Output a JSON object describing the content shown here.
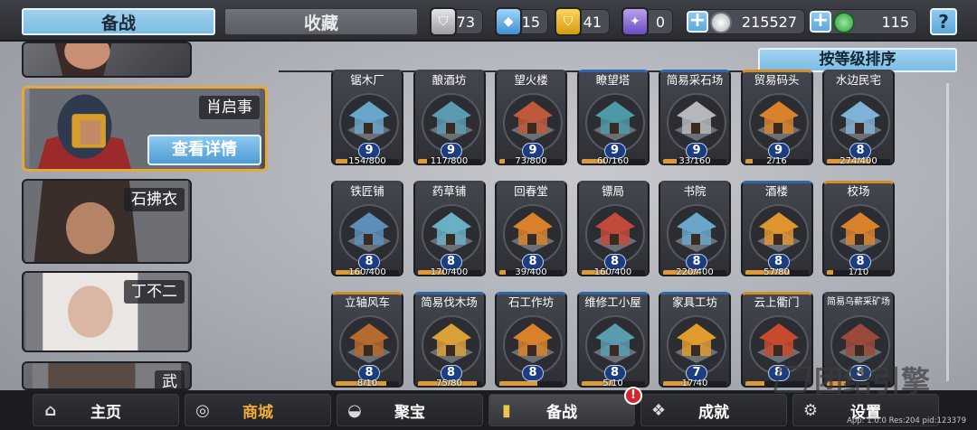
{
  "tabs": {
    "active": "备战",
    "other": "收藏"
  },
  "resources": [
    {
      "icon": "silver-shield-icon",
      "value": "73",
      "color": "#c6c8cd"
    },
    {
      "icon": "blue-crystal-icon",
      "value": "15",
      "color": "#4fa6e6"
    },
    {
      "icon": "gold-shield-icon",
      "value": "41",
      "color": "#e7b022"
    },
    {
      "icon": "purple-crest-icon",
      "value": "0",
      "color": "#8c6bd6"
    }
  ],
  "currency": [
    {
      "icon": "silver-coin-icon",
      "value": "215527",
      "color": "#c2c6cc"
    },
    {
      "icon": "jade-coin-icon",
      "value": "115",
      "color": "#3fb14d"
    }
  ],
  "help_label": "?",
  "heroes": [
    {
      "name": ""
    },
    {
      "name": "肖启事",
      "button": "查看详情"
    },
    {
      "name": "石拂衣"
    },
    {
      "name": "丁不二"
    },
    {
      "name": "武"
    }
  ],
  "sort_label": "按等级排序",
  "buildings": [
    {
      "name": "锯木厂",
      "level": "9",
      "progress": "154/800",
      "pct": 0.19,
      "tint": "#3f434b",
      "accent": "#6aa6c9"
    },
    {
      "name": "酿酒坊",
      "level": "9",
      "progress": "117/800",
      "pct": 0.15,
      "tint": "#3f434b",
      "accent": "#5b9bb0"
    },
    {
      "name": "望火楼",
      "level": "9",
      "progress": "73/800",
      "pct": 0.09,
      "tint": "#3f434b",
      "accent": "#c0583c"
    },
    {
      "name": "瞭望塔",
      "level": "9",
      "progress": "60/160",
      "pct": 0.38,
      "tint": "#2f66a8",
      "accent": "#4d9aa6"
    },
    {
      "name": "简易采石场",
      "level": "9",
      "progress": "33/160",
      "pct": 0.21,
      "tint": "#2f66a8",
      "accent": "#b5b7bb"
    },
    {
      "name": "贸易码头",
      "level": "9",
      "progress": "2/16",
      "pct": 0.12,
      "tint": "#d28a2a",
      "accent": "#d9822b"
    },
    {
      "name": "水边民宅",
      "level": "8",
      "progress": "274/400",
      "pct": 0.68,
      "tint": "#3f434b",
      "accent": "#7fb2d6"
    },
    {
      "name": "铁匠铺",
      "level": "8",
      "progress": "160/400",
      "pct": 0.4,
      "tint": "#3f434b",
      "accent": "#5b8fb8"
    },
    {
      "name": "药草铺",
      "level": "8",
      "progress": "170/400",
      "pct": 0.42,
      "tint": "#3f434b",
      "accent": "#6ab0c4"
    },
    {
      "name": "回春堂",
      "level": "8",
      "progress": "39/400",
      "pct": 0.1,
      "tint": "#3f434b",
      "accent": "#d9822b"
    },
    {
      "name": "镖局",
      "level": "8",
      "progress": "160/400",
      "pct": 0.4,
      "tint": "#3f434b",
      "accent": "#c24a3a"
    },
    {
      "name": "书院",
      "level": "8",
      "progress": "220/400",
      "pct": 0.55,
      "tint": "#3f434b",
      "accent": "#6aa6c9"
    },
    {
      "name": "酒楼",
      "level": "8",
      "progress": "57/80",
      "pct": 0.71,
      "tint": "#2f66a8",
      "accent": "#e0952f"
    },
    {
      "name": "校场",
      "level": "8",
      "progress": "1/10",
      "pct": 0.1,
      "tint": "#d28a2a",
      "accent": "#d9822b"
    },
    {
      "name": "立轴风车",
      "level": "8",
      "progress": "8/10",
      "pct": 0.8,
      "tint": "#d28a2a",
      "accent": "#b56a2e"
    },
    {
      "name": "简易伐木场",
      "level": "8",
      "progress": "75/80",
      "pct": 0.94,
      "tint": "#2f66a8",
      "accent": "#d9a13a"
    },
    {
      "name": "石工作坊",
      "level": "8",
      "progress": "",
      "pct": 0.6,
      "tint": "#2f66a8",
      "accent": "#d9822b"
    },
    {
      "name": "维修工小屋",
      "level": "8",
      "progress": "5/10",
      "pct": 0.5,
      "tint": "#2f66a8",
      "accent": "#5b9bb0"
    },
    {
      "name": "家具工坊",
      "level": "7",
      "progress": "17/40",
      "pct": 0.42,
      "tint": "#2f66a8",
      "accent": "#e09b2f"
    },
    {
      "name": "云上衢门",
      "level": "8",
      "progress": "",
      "pct": 0.3,
      "tint": "#d28a2a",
      "accent": "#c84a2e"
    },
    {
      "name": "简易乌薪采矿场",
      "level": "8",
      "progress": "",
      "pct": 0.3,
      "tint": "#3f434b",
      "accent": "#9a4a3a"
    }
  ],
  "nav": [
    {
      "label": "主页",
      "icon": "home-icon"
    },
    {
      "label": "商城",
      "icon": "coins-icon"
    },
    {
      "label": "聚宝",
      "icon": "treasure-bowl-icon"
    },
    {
      "label": "备战",
      "icon": "card-icon"
    },
    {
      "label": "成就",
      "icon": "blocks-icon"
    },
    {
      "label": "设置",
      "icon": "gear-icon"
    }
  ],
  "badge": "!",
  "watermark": "团结引擎",
  "footer_info": "App: 1.0.0 Res:204 pid:123379"
}
